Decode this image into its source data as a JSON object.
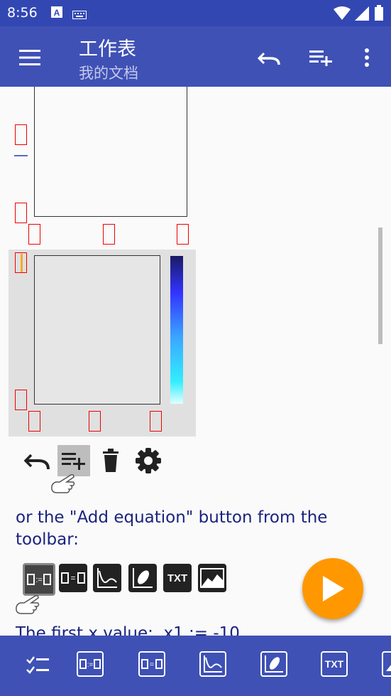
{
  "status": {
    "time": "8:56"
  },
  "appbar": {
    "title": "工作表",
    "subtitle": "我的文档"
  },
  "content": {
    "instruction": "or the \"Add equation\" button from the toolbar:",
    "cut_line": "The first x value:  x1 := -10"
  },
  "bottom_toolbar": {
    "items": [
      "checklist-icon",
      "equation-insert-icon",
      "equation-icon",
      "plot-icon",
      "parametric-plot-icon",
      "txt-icon",
      "image-icon"
    ],
    "txt_label": "TXT"
  },
  "inline_toolbar": {
    "txt_label": "TXT"
  },
  "colors": {
    "primary": "#3f51b5",
    "status": "#3347b3",
    "fab": "#ff9800"
  }
}
